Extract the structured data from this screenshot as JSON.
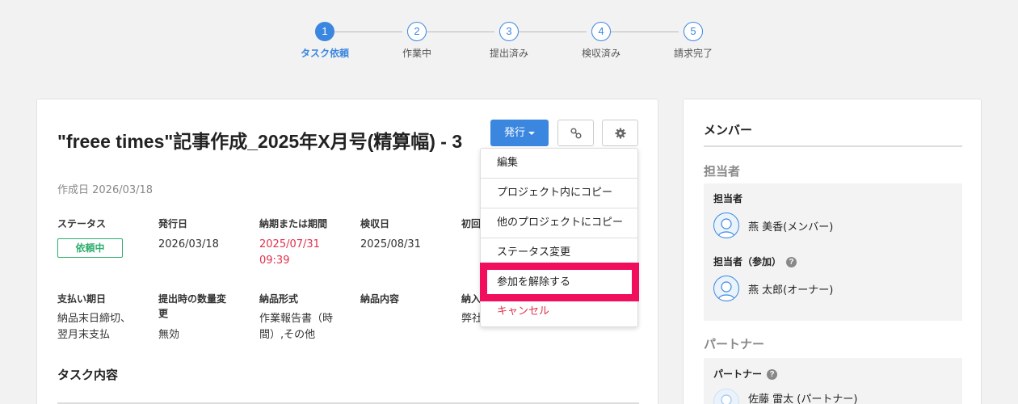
{
  "stepper": {
    "steps": [
      {
        "num": "1",
        "label": "タスク依頼"
      },
      {
        "num": "2",
        "label": "作業中"
      },
      {
        "num": "3",
        "label": "提出済み"
      },
      {
        "num": "4",
        "label": "検収済み"
      },
      {
        "num": "5",
        "label": "請求完了"
      }
    ],
    "active_index": 0
  },
  "task": {
    "title": "\"freee times\"記事作成_2025年X月号(精算幅) - 3",
    "created": "作成日 2026/03/18",
    "fields": {
      "status_label": "ステータス",
      "status_value": "依頼中",
      "issue_date_label": "発行日",
      "issue_date_value": "2026/03/18",
      "deadline_label": "納期または期間",
      "deadline_value_1": "2025/07/31",
      "deadline_value_2": "09:39",
      "inspection_label": "検収日",
      "inspection_value": "2025/08/31",
      "initial_label": "初回",
      "payment_label": "支払い期日",
      "payment_value_1": "納品末日締切、",
      "payment_value_2": "翌月末支払",
      "quantity_label_1": "提出時の数量変",
      "quantity_label_2": "更",
      "quantity_value": "無効",
      "format_label": "納品形式",
      "format_value_1": "作業報告書（時",
      "format_value_2": "間）,その他",
      "content_label": "納品内容",
      "deliver_label": "納入",
      "deliver_value": "弊社"
    },
    "section_title": "タスク内容"
  },
  "toolbar": {
    "issue_label": "発行",
    "link_icon": "link-icon",
    "gear_icon": "gear-icon"
  },
  "dropdown": {
    "items": [
      "編集",
      "プロジェクト内にコピー",
      "他のプロジェクトにコピー",
      "ステータス変更",
      "参加を解除する",
      "キャンセル"
    ]
  },
  "members": {
    "heading": "メンバー",
    "assignee_heading": "担当者",
    "assignee_label": "担当者",
    "assignee_name": "燕 美香(メンバー)",
    "participant_label": "担当者（参加）",
    "participant_name": "燕 太郎(オーナー)",
    "partner_heading": "パートナー",
    "partner_label": "パートナー",
    "partner_name": "佐藤 雷太 (パートナー)"
  },
  "colors": {
    "accent": "#3b87e0",
    "status_green": "#2fae6e",
    "danger": "#e0314b",
    "highlight": "#f10e5d"
  }
}
